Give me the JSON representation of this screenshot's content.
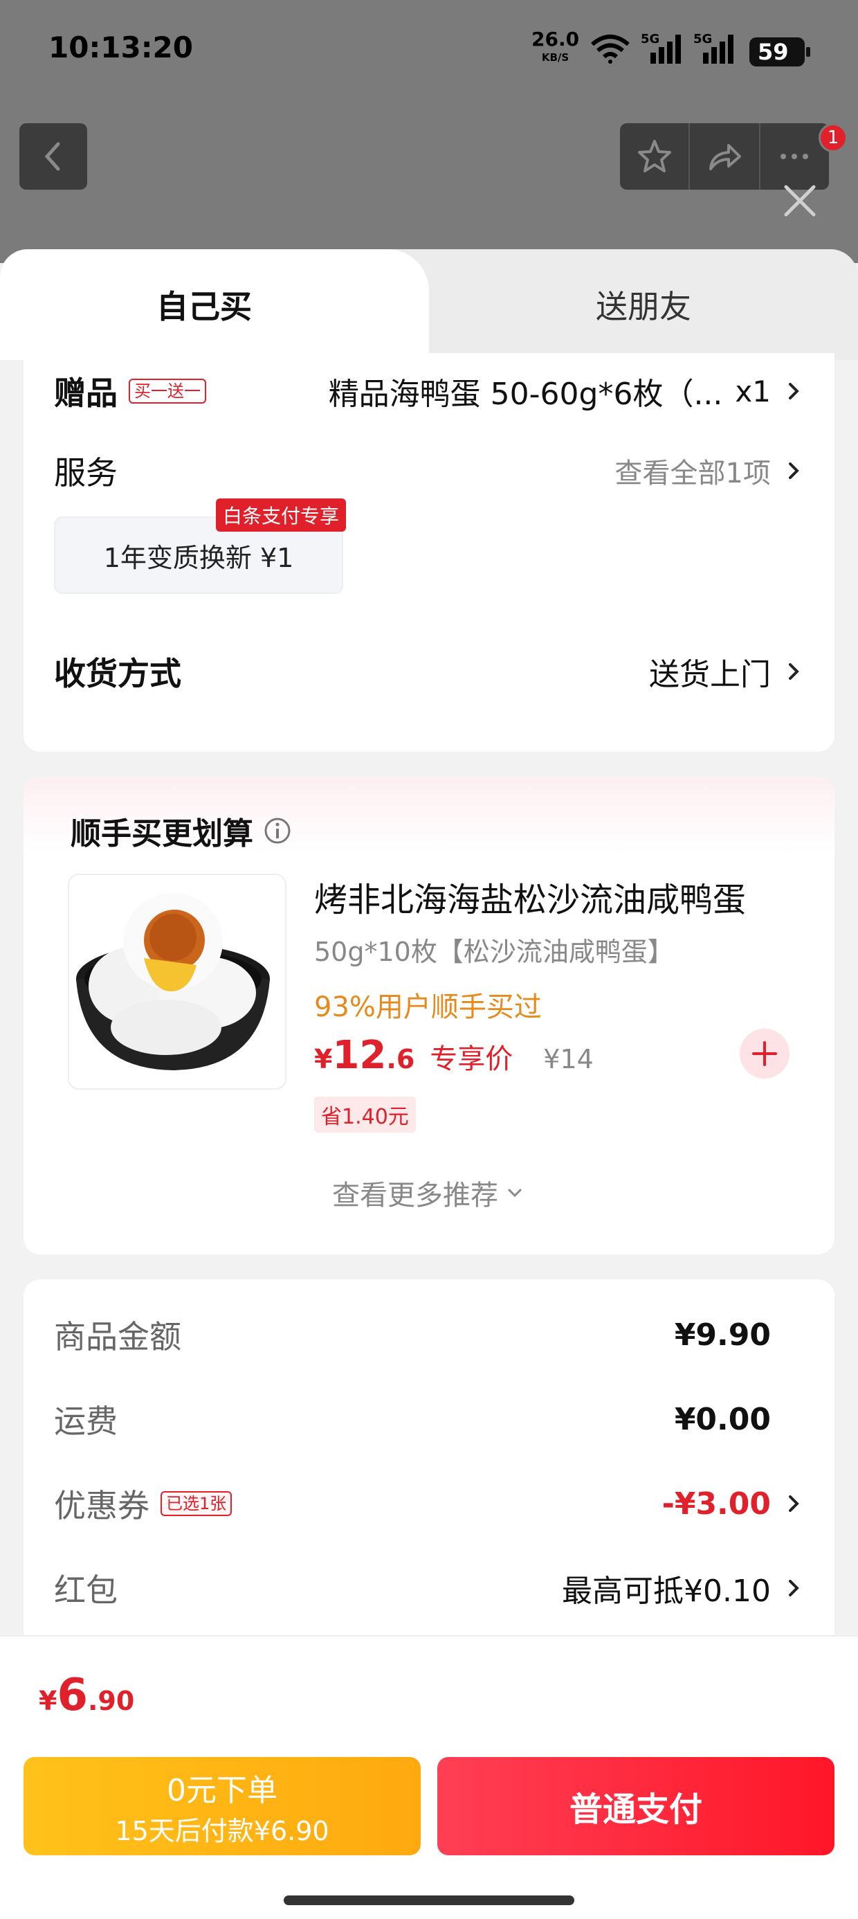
{
  "status_bar": {
    "time": "10:13:20",
    "net_speed": "26.0",
    "net_unit": "KB/S",
    "sig1_label": "5G",
    "sig2_label": "5G",
    "battery": "59"
  },
  "header": {
    "notification_count": "1"
  },
  "tabs": {
    "self": "自己买",
    "gift": "送朋友"
  },
  "gift_row": {
    "label": "赠品",
    "tag": "买一送一",
    "value": "精品海鸭蛋 50-60g*6枚（...",
    "qty": "x1"
  },
  "service_row": {
    "label": "服务",
    "value": "查看全部1项",
    "option_tag": "白条支付专享",
    "option": "1年变质换新  ¥1"
  },
  "delivery_row": {
    "label": "收货方式",
    "value": "送货上门"
  },
  "recommend": {
    "title": "顺手买更划算",
    "product_title": "烤非北海海盐松沙流油咸鸭蛋",
    "product_spec": "50g*10枚【松沙流油咸鸭蛋】",
    "bought_text": "93%用户顺手买过",
    "price_symbol": "¥",
    "price_int": "12",
    "price_dec": ".6",
    "price_label": "专享价",
    "orig_price": "¥14",
    "save_tag": "省1.40元",
    "more": "查看更多推荐"
  },
  "summary": {
    "goods_label": "商品金额",
    "goods_value": "¥9.90",
    "ship_label": "运费",
    "ship_value": "¥0.00",
    "coupon_label": "优惠券",
    "coupon_tag": "已选1张",
    "coupon_value": "-¥3.00",
    "redpack_label": "红包",
    "redpack_value": "最高可抵¥0.10"
  },
  "bottom": {
    "total_symbol": "¥",
    "total_int": "6",
    "total_dec": ".90",
    "btn_later_line1": "0元下单",
    "btn_later_line2": "15天后付款¥6.90",
    "btn_pay": "普通支付"
  },
  "colors": {
    "accent_red": "#e0202a",
    "orange": "#e68a1b",
    "yellow_btn": "#ffb614"
  }
}
